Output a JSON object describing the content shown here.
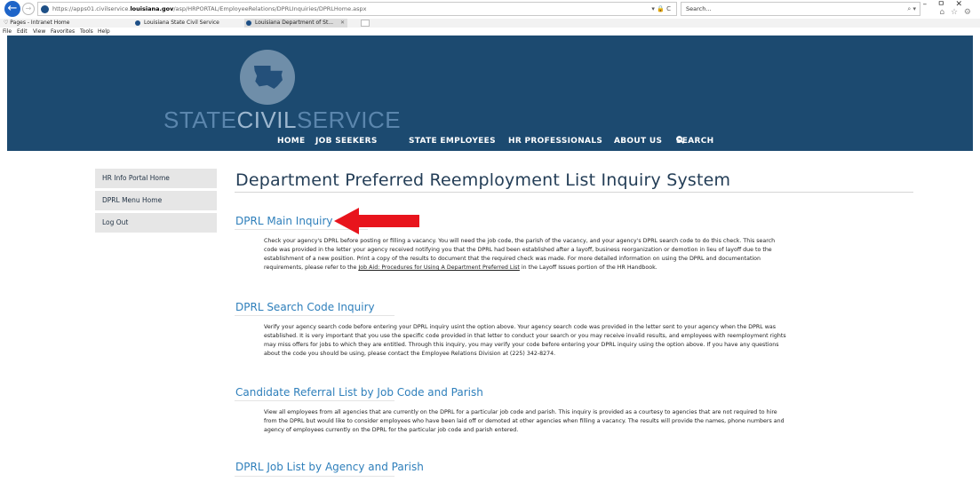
{
  "browser": {
    "url_prefix": "https://apps01.civilservice.",
    "url_domain": "louisiana.gov",
    "url_path": "/asp/HRPORTAL/EmployeeRelations/DPRLInquiries/DPRLHome.aspx",
    "address_tools": "▾ 🔒 C",
    "search_placeholder": "Search...",
    "search_glyph": "⌕ ▾",
    "window_controls": "–ㅁ✕",
    "toolbar_icons": "⌂ ☆ ⚙",
    "favorites": [
      "Pages - Intranet Home"
    ],
    "tabs": [
      {
        "label": "Louisiana State Civil Service",
        "active": false
      },
      {
        "label": "Louisiana Department of St...",
        "active": true
      }
    ],
    "tab_close": "✕",
    "menu": [
      "File",
      "Edit",
      "View",
      "Favorites",
      "Tools",
      "Help"
    ]
  },
  "header": {
    "logo_part1": "STATE",
    "logo_part2": "CIVIL",
    "logo_part3": "SERVICE",
    "nav": [
      "HOME",
      "JOB SEEKERS",
      "STATE EMPLOYEES",
      "HR PROFESSIONALS",
      "ABOUT US",
      "SEARCH"
    ],
    "search_icon": "magnifier"
  },
  "sidebar": {
    "items": [
      "HR Info Portal Home",
      "DPRL Menu Home",
      "Log Out"
    ]
  },
  "page": {
    "title": "Department Preferred Reemployment List Inquiry System"
  },
  "sections": [
    {
      "title": "DPRL Main Inquiry",
      "body": "Check your agency's DPRL before posting or filling a vacancy.  You will need the job code, the parish of the vacancy, and your agency's DPRL search code to do this check.  This search code was provided in the letter your agency received notifying you that the DPRL had been established after a layoff, business reorganization or demotion in lieu of layoff due to the establishment of a new position.  Print a copy of the results to document that the required check was made.  For more detailed information on using the DPRL and documentation requirements, please refer to the ",
      "link": "Job Aid: Procedures for Using A Department Preferred List",
      "body_after": " in the Layoff Issues portion of the HR Handbook."
    },
    {
      "title": "DPRL Search Code Inquiry",
      "body": "Verify your agency search code before entering your DPRL inquiry usint the option above. Your agency search code was provided in the letter sent to your agency when the DPRL was established.  It is very important that you use the specific code provided in that letter to conduct your search or you may receive invalid results, and employees with reemployment rights may miss offers for jobs to which they are entitled.  Through this inquiry, you may verify your code before entering your DPRL inquiry using the option above.  If you have any questions about the code you should be using, please contact the Employee Relations Division at (225) 342-8274."
    },
    {
      "title": "Candidate Referral List by Job Code and Parish",
      "body": "View all employees from all agencies that are currently on the DPRL for a particular job code and parish.  This inquiry is provided as a courtesy to agencies that are not required to hire from the DPRL but would like to consider employees who have been laid off or demoted at other agencies when filling a vacancy.  The results will provide the names, phone numbers and agency of employees currently on the DPRL for the particular job code and parish entered."
    },
    {
      "title": "DPRL Job List by Agency and Parish"
    }
  ],
  "colors": {
    "header_bg": "#1c4a70",
    "link_blue": "#2e7fbb",
    "title_navy": "#243e57",
    "arrow_red": "#e8141c"
  }
}
